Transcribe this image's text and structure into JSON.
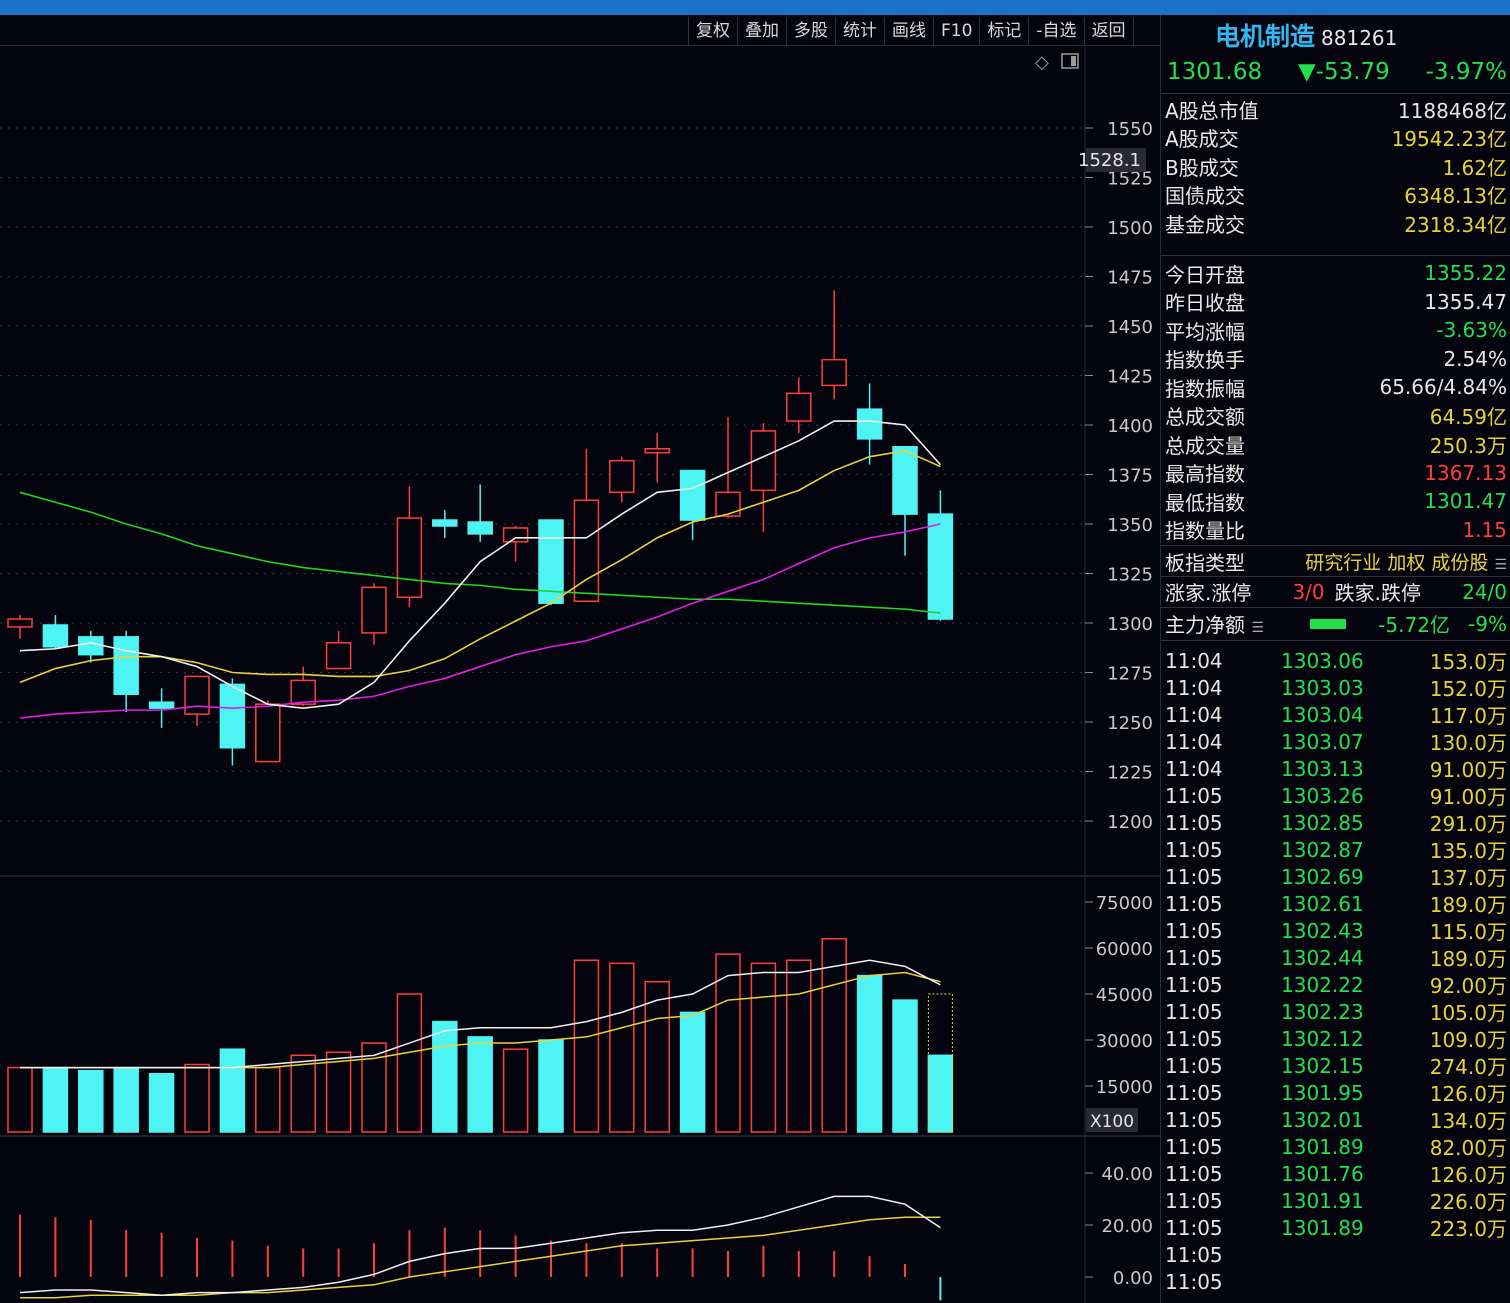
{
  "toolbar": {
    "items": [
      "复权",
      "叠加",
      "多股",
      "统计",
      "画线",
      "F10",
      "标记",
      "-自选",
      "返回"
    ]
  },
  "chart_icons": [
    "diamond-icon",
    "panel-toggle-icon"
  ],
  "main_axis": {
    "ticks": [
      "1550",
      "1525",
      "1500",
      "1475",
      "1450",
      "1425",
      "1400",
      "1375",
      "1350",
      "1325",
      "1300",
      "1275",
      "1250",
      "1225",
      "1200"
    ],
    "crosshair_label": "1528.1"
  },
  "volume_axis": {
    "ticks": [
      "75000",
      "60000",
      "45000",
      "30000",
      "15000"
    ],
    "unit": "X100"
  },
  "indicator_axis": {
    "ticks": [
      "40.00",
      "20.00",
      "0.00"
    ]
  },
  "colors": {
    "up": "#ff3d3d",
    "down": "#4ef4f4",
    "ma5": "#f0f0f0",
    "ma10": "#e8d23a",
    "ma20": "#e21ee0",
    "ma60": "#22d41c",
    "accent": "#34b7f0"
  },
  "chart_data": {
    "type": "candlestick",
    "candles": [
      {
        "o": 1298,
        "h": 1304,
        "l": 1292,
        "c": 1302
      },
      {
        "o": 1299,
        "h": 1304,
        "l": 1287,
        "c": 1288
      },
      {
        "o": 1293,
        "h": 1296,
        "l": 1280,
        "c": 1284
      },
      {
        "o": 1293,
        "h": 1296,
        "l": 1255,
        "c": 1264
      },
      {
        "o": 1260,
        "h": 1267,
        "l": 1247,
        "c": 1257
      },
      {
        "o": 1254,
        "h": 1263,
        "l": 1248,
        "c": 1273
      },
      {
        "o": 1269,
        "h": 1272,
        "l": 1228,
        "c": 1237
      },
      {
        "o": 1230,
        "h": 1261,
        "l": 1230,
        "c": 1259
      },
      {
        "o": 1259,
        "h": 1278,
        "l": 1258,
        "c": 1271
      },
      {
        "o": 1277,
        "h": 1296,
        "l": 1277,
        "c": 1290
      },
      {
        "o": 1295,
        "h": 1320,
        "l": 1289,
        "c": 1318
      },
      {
        "o": 1313,
        "h": 1369,
        "l": 1308,
        "c": 1353
      },
      {
        "o": 1352,
        "h": 1357,
        "l": 1343,
        "c": 1349
      },
      {
        "o": 1351,
        "h": 1370,
        "l": 1341,
        "c": 1345
      },
      {
        "o": 1341,
        "h": 1349,
        "l": 1331,
        "c": 1348
      },
      {
        "o": 1352,
        "h": 1352,
        "l": 1309,
        "c": 1310
      },
      {
        "o": 1311,
        "h": 1388,
        "l": 1311,
        "c": 1362
      },
      {
        "o": 1366,
        "h": 1384,
        "l": 1361,
        "c": 1382
      },
      {
        "o": 1386,
        "h": 1396,
        "l": 1371,
        "c": 1388
      },
      {
        "o": 1377,
        "h": 1377,
        "l": 1342,
        "c": 1352
      },
      {
        "o": 1354,
        "h": 1404,
        "l": 1353,
        "c": 1366
      },
      {
        "o": 1367,
        "h": 1401,
        "l": 1346,
        "c": 1397
      },
      {
        "o": 1402,
        "h": 1424,
        "l": 1396,
        "c": 1416
      },
      {
        "o": 1420,
        "h": 1468,
        "l": 1413,
        "c": 1433
      },
      {
        "o": 1408,
        "h": 1421,
        "l": 1380,
        "c": 1393
      },
      {
        "o": 1389,
        "h": 1389,
        "l": 1334,
        "c": 1355
      },
      {
        "o": 1355,
        "h": 1367,
        "l": 1301,
        "c": 1302
      }
    ],
    "volumes": [
      21000,
      21000,
      20000,
      21000,
      19000,
      22000,
      27000,
      21000,
      25000,
      26000,
      29000,
      45000,
      36000,
      31000,
      27000,
      30000,
      56000,
      55000,
      49000,
      39000,
      58000,
      55000,
      56000,
      63000,
      51000,
      43000,
      25000
    ],
    "volume_ghost": 45000,
    "ma5": [
      1286,
      1287,
      1290,
      1286,
      1283,
      1278,
      1268,
      1259,
      1257,
      1259,
      1270,
      1291,
      1310,
      1331,
      1343,
      1343,
      1343,
      1355,
      1366,
      1368,
      1376,
      1384,
      1392,
      1402,
      1402,
      1400,
      1380
    ],
    "ma10": [
      1270,
      1277,
      1281,
      1283,
      1283,
      1280,
      1275,
      1274,
      1274,
      1273,
      1273,
      1276,
      1282,
      1292,
      1301,
      1310,
      1322,
      1332,
      1343,
      1351,
      1355,
      1361,
      1367,
      1377,
      1384,
      1387,
      1379
    ],
    "ma20": [
      1252,
      1254,
      1255,
      1256,
      1256,
      1258,
      1257,
      1258,
      1260,
      1261,
      1263,
      1268,
      1272,
      1278,
      1284,
      1288,
      1291,
      1297,
      1303,
      1310,
      1316,
      1322,
      1330,
      1338,
      1343,
      1346,
      1350
    ],
    "ma60": [
      1366,
      1361,
      1356,
      1350,
      1345,
      1339,
      1335,
      1331,
      1328,
      1326,
      1324,
      1322,
      1320,
      1319,
      1317,
      1316,
      1315,
      1314,
      1313,
      1312,
      1312,
      1311,
      1310,
      1309,
      1308,
      1307,
      1305
    ],
    "vol_ma5": [
      21000,
      21000,
      21000,
      21000,
      21000,
      21000,
      21000,
      22000,
      23000,
      24000,
      25000,
      29000,
      33000,
      34000,
      34000,
      34000,
      36000,
      39000,
      43000,
      45000,
      51000,
      52000,
      52000,
      54000,
      56000,
      54000,
      48000
    ],
    "vol_ma10": [
      21000,
      21000,
      21000,
      21000,
      21000,
      21000,
      21000,
      21000,
      22000,
      23000,
      24000,
      26000,
      28000,
      29000,
      29000,
      30000,
      31000,
      34000,
      37000,
      38000,
      43000,
      44000,
      45000,
      48000,
      51000,
      52000,
      49000
    ],
    "ind_bars": [
      24,
      23,
      22,
      18,
      17,
      15,
      14,
      12,
      11,
      11,
      13,
      18,
      19,
      18,
      16,
      14,
      13,
      13,
      11,
      11,
      10,
      12,
      10,
      10,
      8,
      5,
      -9
    ],
    "ind_line1": [
      -6,
      -5,
      -5,
      -6,
      -7,
      -6,
      -6,
      -5,
      -4,
      -2,
      1,
      6,
      9,
      11,
      11,
      13,
      15,
      17,
      18,
      18,
      20,
      23,
      27,
      31,
      31,
      28,
      19
    ],
    "ind_line2": [
      -8,
      -8,
      -7,
      -7,
      -7,
      -7,
      -6,
      -6,
      -5,
      -4,
      -3,
      0,
      2,
      4,
      6,
      8,
      10,
      12,
      13,
      14,
      15,
      16,
      18,
      20,
      22,
      23,
      23
    ],
    "ylim": [
      1200,
      1550
    ]
  },
  "panel": {
    "name": "电机制造",
    "code": "881261",
    "price": "1301.68",
    "change": "▼-53.79",
    "change_pct": "-3.97%",
    "market_rows": [
      {
        "label": "A股总市值",
        "value": "1188468亿",
        "color": "white"
      },
      {
        "label": "A股成交",
        "value": "19542.23亿",
        "color": "yellow"
      },
      {
        "label": "B股成交",
        "value": "1.62亿",
        "color": "yellow"
      },
      {
        "label": "国债成交",
        "value": "6348.13亿",
        "color": "yellow"
      },
      {
        "label": "基金成交",
        "value": "2318.34亿",
        "color": "yellow"
      }
    ],
    "stat_rows": [
      {
        "label": "今日开盘",
        "value": "1355.22",
        "color": "green"
      },
      {
        "label": "昨日收盘",
        "value": "1355.47",
        "color": "white"
      },
      {
        "label": "平均涨幅",
        "value": "-3.63%",
        "color": "green"
      },
      {
        "label": "指数换手",
        "value": "2.54%",
        "color": "white"
      },
      {
        "label": "指数振幅",
        "value": "65.66/4.84%",
        "color": "white"
      },
      {
        "label": "总成交额",
        "value": "64.59亿",
        "color": "yellow"
      },
      {
        "label": "总成交量",
        "value": "250.3万",
        "color": "yellow"
      },
      {
        "label": "最高指数",
        "value": "1367.13",
        "color": "red"
      },
      {
        "label": "最低指数",
        "value": "1301.47",
        "color": "green"
      },
      {
        "label": "指数量比",
        "value": "1.15",
        "color": "red"
      }
    ],
    "sector": {
      "label": "板指类型",
      "value": "研究行业 加权 成份股"
    },
    "updown": {
      "label": "涨家.涨停",
      "up": "3/0",
      "label2": "跌家.跌停",
      "down": "24/0"
    },
    "main_money": {
      "label": "主力净额",
      "amount": "-5.72亿",
      "pct": "-9%"
    },
    "ticks": [
      {
        "t": "11:04",
        "p": "1303.06",
        "v": "153.0万"
      },
      {
        "t": "11:04",
        "p": "1303.03",
        "v": "152.0万"
      },
      {
        "t": "11:04",
        "p": "1303.04",
        "v": "117.0万"
      },
      {
        "t": "11:04",
        "p": "1303.07",
        "v": "130.0万"
      },
      {
        "t": "11:04",
        "p": "1303.13",
        "v": "91.00万"
      },
      {
        "t": "11:05",
        "p": "1303.26",
        "v": "91.00万"
      },
      {
        "t": "11:05",
        "p": "1302.85",
        "v": "291.0万"
      },
      {
        "t": "11:05",
        "p": "1302.87",
        "v": "135.0万"
      },
      {
        "t": "11:05",
        "p": "1302.69",
        "v": "137.0万"
      },
      {
        "t": "11:05",
        "p": "1302.61",
        "v": "189.0万"
      },
      {
        "t": "11:05",
        "p": "1302.43",
        "v": "115.0万"
      },
      {
        "t": "11:05",
        "p": "1302.44",
        "v": "189.0万"
      },
      {
        "t": "11:05",
        "p": "1302.22",
        "v": "92.00万"
      },
      {
        "t": "11:05",
        "p": "1302.23",
        "v": "105.0万"
      },
      {
        "t": "11:05",
        "p": "1302.12",
        "v": "109.0万"
      },
      {
        "t": "11:05",
        "p": "1302.15",
        "v": "274.0万"
      },
      {
        "t": "11:05",
        "p": "1301.95",
        "v": "126.0万"
      },
      {
        "t": "11:05",
        "p": "1302.01",
        "v": "134.0万"
      },
      {
        "t": "11:05",
        "p": "1301.89",
        "v": "82.00万"
      },
      {
        "t": "11:05",
        "p": "1301.76",
        "v": "126.0万"
      },
      {
        "t": "11:05",
        "p": "1301.91",
        "v": "226.0万"
      },
      {
        "t": "11:05",
        "p": "1301.89",
        "v": "223.0万"
      },
      {
        "t": "11:05",
        "p": "",
        "v": ""
      },
      {
        "t": "11:05",
        "p": "",
        "v": ""
      }
    ]
  }
}
